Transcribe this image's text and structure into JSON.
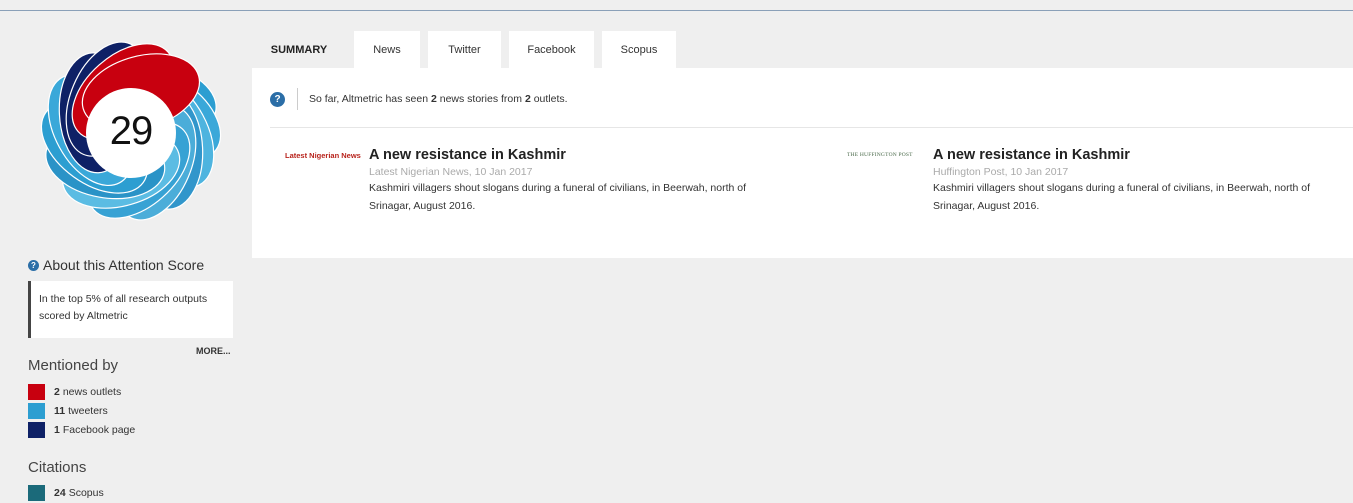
{
  "sidebar": {
    "score": "29",
    "about_label": "About this Attention Score",
    "top_box_text": "In the top 5% of all research outputs scored by Altmetric",
    "more_label": "MORE...",
    "mentioned_title": "Mentioned by",
    "mentions": [
      {
        "count": "2",
        "label": "news outlets",
        "color": "#c8000f"
      },
      {
        "count": "11",
        "label": "tweeters",
        "color": "#2c9ed1"
      },
      {
        "count": "1",
        "label": "Facebook page",
        "color": "#0e2166"
      }
    ],
    "citations_title": "Citations",
    "citations": [
      {
        "count": "24",
        "label": "Scopus",
        "color": "#1b6a7a"
      }
    ],
    "donut_colors": {
      "news": "#c8000f",
      "twitter": "#2c9ed1",
      "facebook": "#0e2166"
    }
  },
  "tabs": [
    "SUMMARY",
    "News",
    "Twitter",
    "Facebook",
    "Scopus"
  ],
  "info": {
    "prefix": "So far, Altmetric has seen ",
    "stories": "2",
    "middle": " news stories from ",
    "outlets": "2",
    "suffix": " outlets."
  },
  "stories": [
    {
      "logo_text": "Latest Nigerian News",
      "title": "A new resistance in Kashmir",
      "meta": "Latest Nigerian News, 10 Jan 2017",
      "body": "Kashmiri villagers shout slogans during a funeral of civilians, in Beerwah, north of Srinagar, August 2016."
    },
    {
      "logo_text": "THE HUFFINGTON POST",
      "title": "A new resistance in Kashmir",
      "meta": "Huffington Post, 10 Jan 2017",
      "body": "Kashmiri villagers shout slogans during a funeral of civilians, in Beerwah, north of Srinagar, August 2016."
    }
  ]
}
